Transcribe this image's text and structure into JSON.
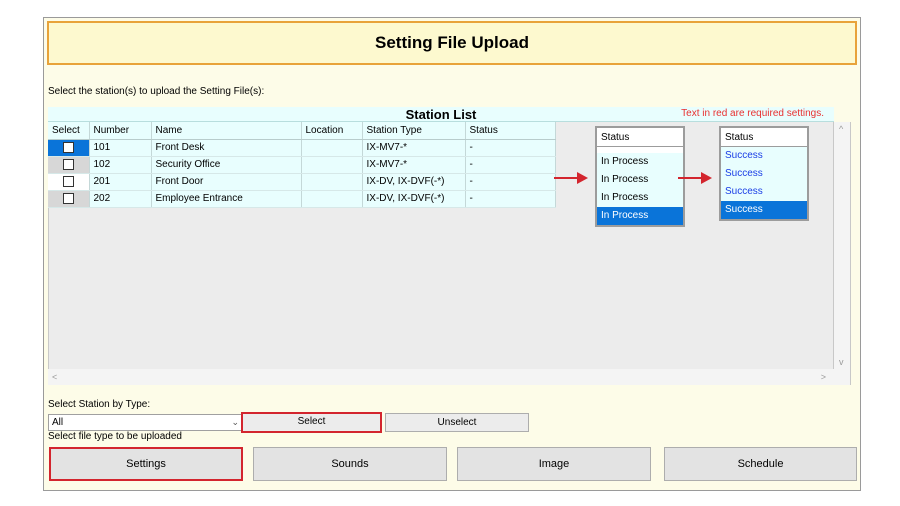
{
  "window": {
    "title": "Setting File Upload"
  },
  "instructions": {
    "select_stations": "Select the station(s) to upload the Setting File(s):"
  },
  "station_list": {
    "title": "Station List",
    "required_note": "Text in red are required settings.",
    "columns": [
      "Select",
      "Number",
      "Name",
      "Location",
      "Station Type",
      "Status"
    ],
    "rows": [
      {
        "number": "101",
        "name": "Front Desk",
        "location": "",
        "type": "IX-MV7-*",
        "status": "-"
      },
      {
        "number": "102",
        "name": "Security Office",
        "location": "",
        "type": "IX-MV7-*",
        "status": "-"
      },
      {
        "number": "201",
        "name": "Front Door",
        "location": "",
        "type": "IX-DV, IX-DVF(-*)",
        "status": "-"
      },
      {
        "number": "202",
        "name": "Employee Entrance",
        "location": "",
        "type": "IX-DV, IX-DVF(-*)",
        "status": "-"
      }
    ]
  },
  "status_popups": {
    "in_process": {
      "header": "Status",
      "items": [
        "In Process",
        "In Process",
        "In Process",
        "In Process"
      ]
    },
    "success": {
      "header": "Status",
      "items": [
        "Success",
        "Success",
        "Success",
        "Success"
      ]
    }
  },
  "select_by_type": {
    "label": "Select Station by Type:",
    "combo_value": "All",
    "select_label": "Select",
    "unselect_label": "Unselect"
  },
  "file_type": {
    "label": "Select file type to be uploaded",
    "buttons": [
      "Settings",
      "Sounds",
      "Image",
      "Schedule"
    ]
  },
  "scroll": {
    "up": "^",
    "down": "v",
    "left": "<",
    "right": ">"
  },
  "colors": {
    "selection_blue": "#0a74d9",
    "required_red": "#e83030",
    "highlight_border": "#d3252e",
    "title_border": "#e8a33a"
  }
}
